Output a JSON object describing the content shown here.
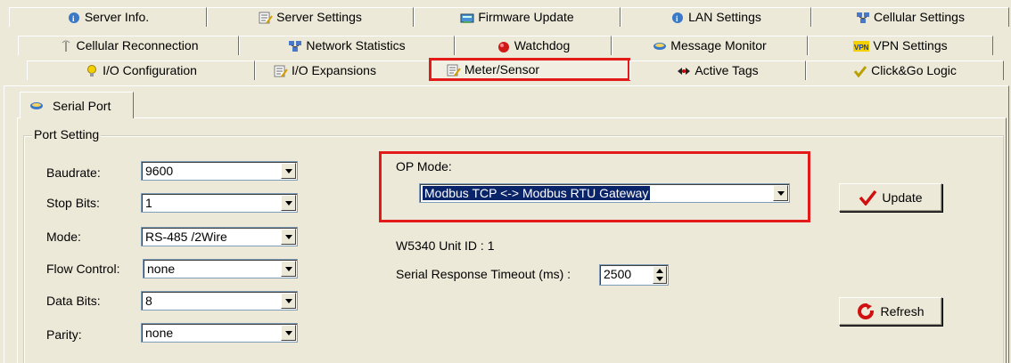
{
  "tabs": {
    "row1": [
      "Server Info.",
      "Server Settings",
      "Firmware Update",
      "LAN Settings",
      "Cellular Settings"
    ],
    "row2": [
      "Cellular Reconnection",
      "Network Statistics",
      "Watchdog",
      "Message Monitor",
      "VPN Settings"
    ],
    "row3": [
      "I/O Configuration",
      "I/O Expansions",
      "Meter/Sensor",
      "Active Tags",
      "Click&Go Logic"
    ]
  },
  "vpn_badge": "VPN",
  "subtab": {
    "label": "Serial Port"
  },
  "port_setting": {
    "group_label": "Port Setting",
    "baudrate": {
      "label": "Baudrate:",
      "value": "9600"
    },
    "stop_bits": {
      "label": "Stop Bits:",
      "value": "1"
    },
    "mode": {
      "label": "Mode:",
      "value": "RS-485 /2Wire"
    },
    "flow_control": {
      "label": "Flow Control:",
      "value": "none"
    },
    "data_bits": {
      "label": "Data Bits:",
      "value": "8"
    },
    "parity": {
      "label": "Parity:",
      "value": "none"
    }
  },
  "op_mode": {
    "label": "OP Mode:",
    "value": "Modbus TCP <-> Modbus RTU Gateway"
  },
  "unit_id": "W5340 Unit ID : 1",
  "timeout": {
    "label": "Serial Response Timeout (ms) :",
    "value": "2500"
  },
  "buttons": {
    "update": "Update",
    "refresh": "Refresh"
  },
  "colors": {
    "highlight": "#e31a1a",
    "selection": "#0a246a",
    "face": "#ece9d8"
  }
}
